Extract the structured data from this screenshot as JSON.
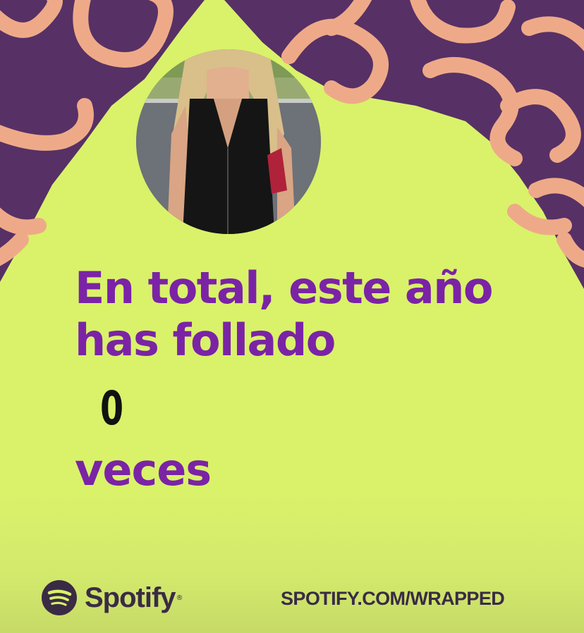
{
  "headline": {
    "line1": "En total, este año",
    "line2": "has follado"
  },
  "count": "0",
  "unit": "veces",
  "footer": {
    "brand_name": "Spotify",
    "brand_mark": "®",
    "url": "SPOTIFY.COM/WRAPPED"
  },
  "colors": {
    "background": "#d9f26a",
    "shape": "#573065",
    "squiggle": "#eeaa88",
    "headline": "#7b23a6",
    "count": "#111111",
    "footer_text": "#3a2b45"
  },
  "icons": {
    "avatar": "profile-photo",
    "brand": "spotify-logo-icon"
  }
}
